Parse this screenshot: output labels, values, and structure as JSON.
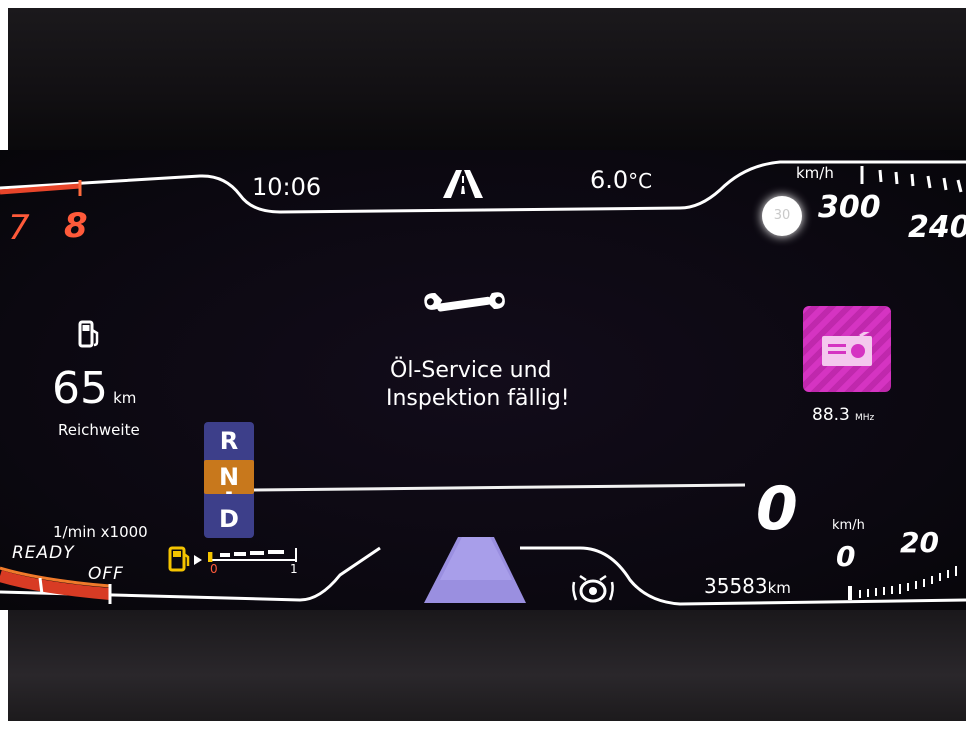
{
  "status_bar": {
    "time": "10:06",
    "outside_temp": "6.0",
    "temp_unit": "°C",
    "road_icon": "road-icon"
  },
  "tachometer": {
    "tick_7": "7",
    "tick_8": "8",
    "unit": "1/min x1000",
    "ready_label": "READY",
    "off_label": "OFF",
    "accent_color": "#e8452a"
  },
  "range": {
    "icon": "fuel-pump-icon",
    "value": "65",
    "unit": "km",
    "label": "Reichweite"
  },
  "service_message": {
    "icon": "wrench-icon",
    "line1": "Öl-Service und",
    "line2": "Inspektion fällig!"
  },
  "gear_selector": {
    "options": [
      "R",
      "N",
      "-",
      "D"
    ],
    "active": "N",
    "active_color": "#c8781c"
  },
  "fuel_gauge": {
    "icon": "fuel-can-icon",
    "min_label": "0",
    "max_label": "1",
    "level": 0.05,
    "warning_color": "#f5c400"
  },
  "speedometer": {
    "unit_top": "km/h",
    "speed_limit_sign": "30",
    "tick_300": "300",
    "tick_240": "240",
    "current_speed": "0",
    "current_speed_unit": "km/h",
    "tick_0": "0",
    "tick_20": "20"
  },
  "media": {
    "icon": "radio-icon",
    "frequency": "88.3",
    "frequency_unit": "MHz",
    "tile_color": "#d534c2"
  },
  "odometer": {
    "value": "35583",
    "unit": "km"
  },
  "assist_icon": "driver-assist-icon"
}
